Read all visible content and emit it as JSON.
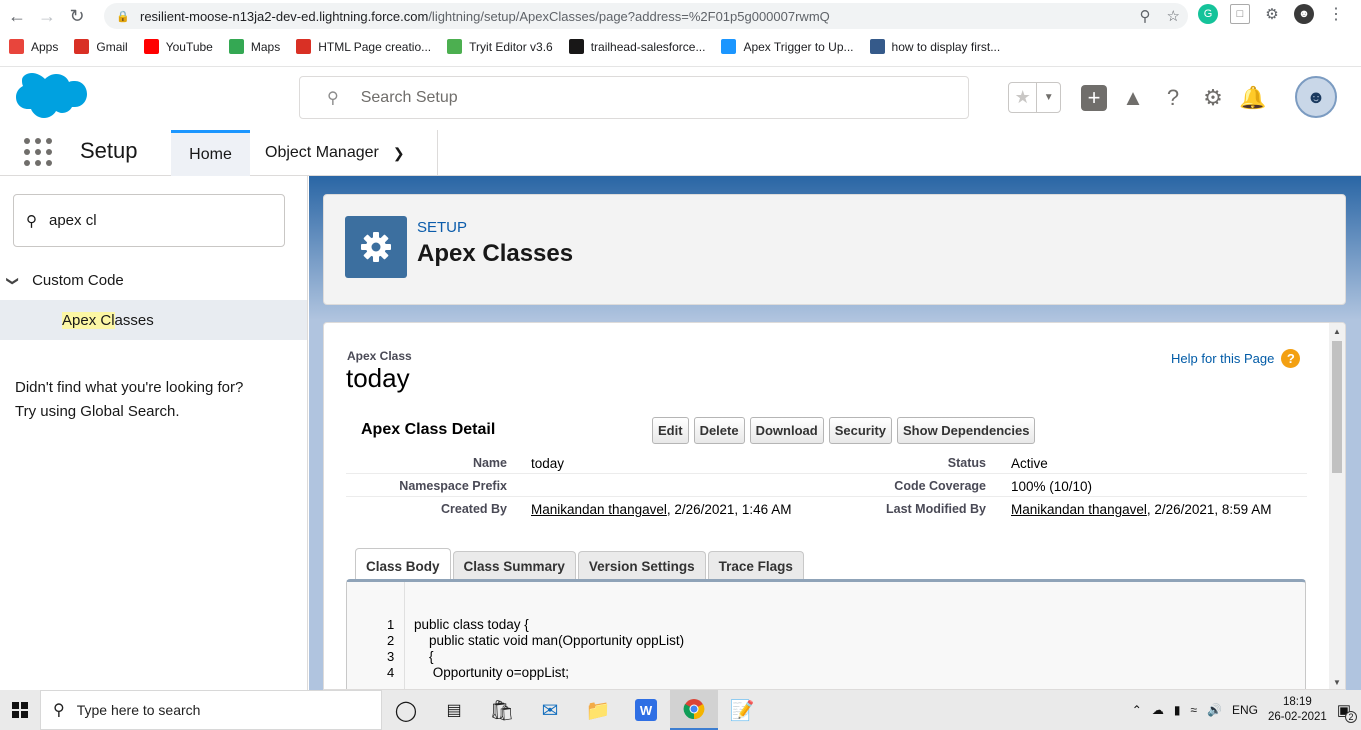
{
  "browser": {
    "url_host": "resilient-moose-n13ja2-dev-ed.lightning.force.com",
    "url_path": "/lightning/setup/ApexClasses/page?address=%2F01p5g000007rwmQ",
    "bookmarks": [
      {
        "label": "Apps",
        "icon": "apps-grid-icon",
        "color": "#e8453c"
      },
      {
        "label": "Gmail",
        "icon": "gmail-icon",
        "color": "#d93025"
      },
      {
        "label": "YouTube",
        "icon": "youtube-icon",
        "color": "#ff0000"
      },
      {
        "label": "Maps",
        "icon": "maps-icon",
        "color": "#34a853"
      },
      {
        "label": "HTML Page creatio...",
        "icon": "gmail-icon",
        "color": "#d93025"
      },
      {
        "label": "Tryit Editor v3.6",
        "icon": "w3schools-icon",
        "color": "#4caf50"
      },
      {
        "label": "trailhead-salesforce...",
        "icon": "github-icon",
        "color": "#181717"
      },
      {
        "label": "Apex Trigger to Up...",
        "icon": "salesforce-cloud-icon",
        "color": "#1b96ff"
      },
      {
        "label": "how to display first...",
        "icon": "cloud-icon",
        "color": "#355a8a"
      }
    ]
  },
  "sf": {
    "search_placeholder": "Search Setup",
    "app_name": "Setup",
    "tabs": {
      "home": "Home",
      "object_manager": "Object Manager"
    }
  },
  "sidebar": {
    "quick_find_value": "apex cl",
    "section": "Custom Code",
    "item_highlight": "Apex Cl",
    "item_rest": "asses",
    "not_found_line1": "Didn't find what you're looking for?",
    "not_found_line2": "Try using Global Search."
  },
  "page": {
    "breadcrumb": "SETUP",
    "title": "Apex Classes"
  },
  "detail": {
    "class_label": "Apex Class",
    "class_name": "today",
    "help_text": "Help for this Page",
    "section_title": "Apex Class Detail",
    "buttons": [
      "Edit",
      "Delete",
      "Download",
      "Security",
      "Show Dependencies"
    ],
    "fields": {
      "name_label": "Name",
      "name_value": "today",
      "status_label": "Status",
      "status_value": "Active",
      "ns_label": "Namespace Prefix",
      "ns_value": "",
      "coverage_label": "Code Coverage",
      "coverage_value": "100% (10/10)",
      "created_label": "Created By",
      "created_user": "Manikandan thangavel",
      "created_date": ", 2/26/2021, 1:46 AM",
      "modified_label": "Last Modified By",
      "modified_user": "Manikandan thangavel",
      "modified_date": ", 2/26/2021, 8:59 AM"
    },
    "tabs": [
      "Class Body",
      "Class Summary",
      "Version Settings",
      "Trace Flags"
    ],
    "code": [
      {
        "n": "1",
        "text": "public class today {"
      },
      {
        "n": "2",
        "text": "    public static void man(Opportunity oppList)"
      },
      {
        "n": "3",
        "text": "    {"
      },
      {
        "n": "4",
        "text": "     Opportunity o=oppList;"
      }
    ]
  },
  "taskbar": {
    "search_placeholder": "Type here to search",
    "lang": "ENG",
    "time": "18:19",
    "date": "26-02-2021",
    "notifications": "2"
  }
}
